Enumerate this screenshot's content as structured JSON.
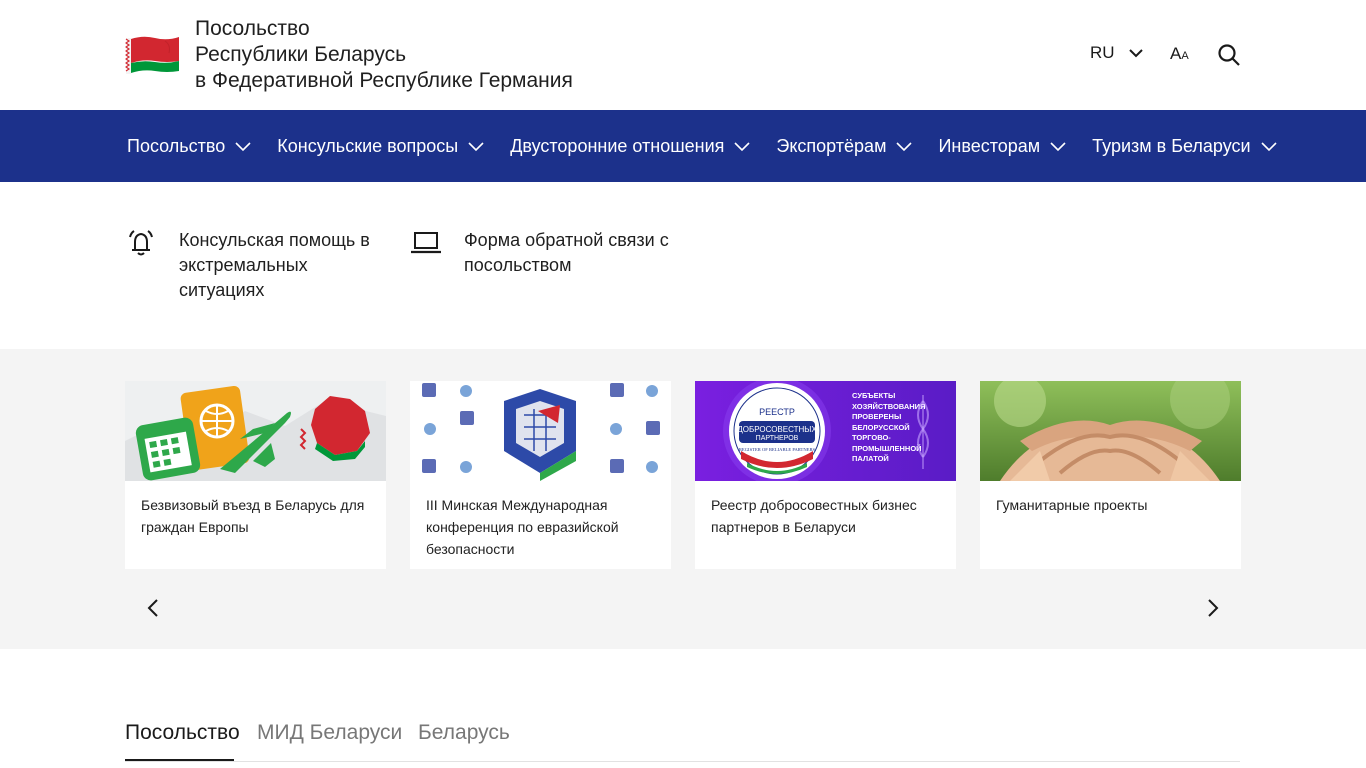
{
  "header": {
    "title_lines": [
      "Посольство",
      "Республики Беларусь",
      "в Федеративной Республике Германия"
    ],
    "language": "RU",
    "font_size_label_big": "A",
    "font_size_label_small": "A"
  },
  "nav": {
    "items": [
      {
        "label": "Посольство"
      },
      {
        "label": "Консульские вопросы"
      },
      {
        "label": "Двусторонние отношения"
      },
      {
        "label": "Экспортёрам"
      },
      {
        "label": "Инвесторам"
      },
      {
        "label": "Туризм в Беларуси"
      }
    ]
  },
  "quick_links": [
    {
      "label": "Консульская помощь в экстремальных ситуациях",
      "icon": "alarm-bell-icon"
    },
    {
      "label": "Форма обратной связи с посольством",
      "icon": "laptop-icon"
    }
  ],
  "carousel": {
    "cards": [
      {
        "title": "Безвизовый въезд в Беларусь для граждан Европы"
      },
      {
        "title": "III Минская Международная конференция по евразийской безопасности"
      },
      {
        "title": "Реестр добросовестных бизнес партнеров в Беларуси",
        "image_text": {
          "badge_line1": "РЕЕСТР",
          "badge_line2": "ДОБРОСОВЕСТНЫХ",
          "badge_line3": "ПАРТНЕРОВ",
          "badge_ring": "REGISTER OF RELIABLE PARTNERS",
          "side_text": "СУБЪЕКТЫ ХОЗЯЙСТВОВАНИЯ ПРОВЕРЕНЫ БЕЛОРУССКОЙ ТОРГОВО-ПРОМЫШЛЕННОЙ ПАЛАТОЙ"
        }
      },
      {
        "title": "Гуманитарные проекты"
      }
    ]
  },
  "tabs": [
    {
      "label": "Посольство",
      "active": true
    },
    {
      "label": "МИД Беларуси",
      "active": false
    },
    {
      "label": "Беларусь",
      "active": false
    }
  ],
  "colors": {
    "nav_bg": "#1c318b",
    "flag_red": "#d22730",
    "flag_green": "#009739",
    "carousel_bg": "#f4f4f4"
  }
}
